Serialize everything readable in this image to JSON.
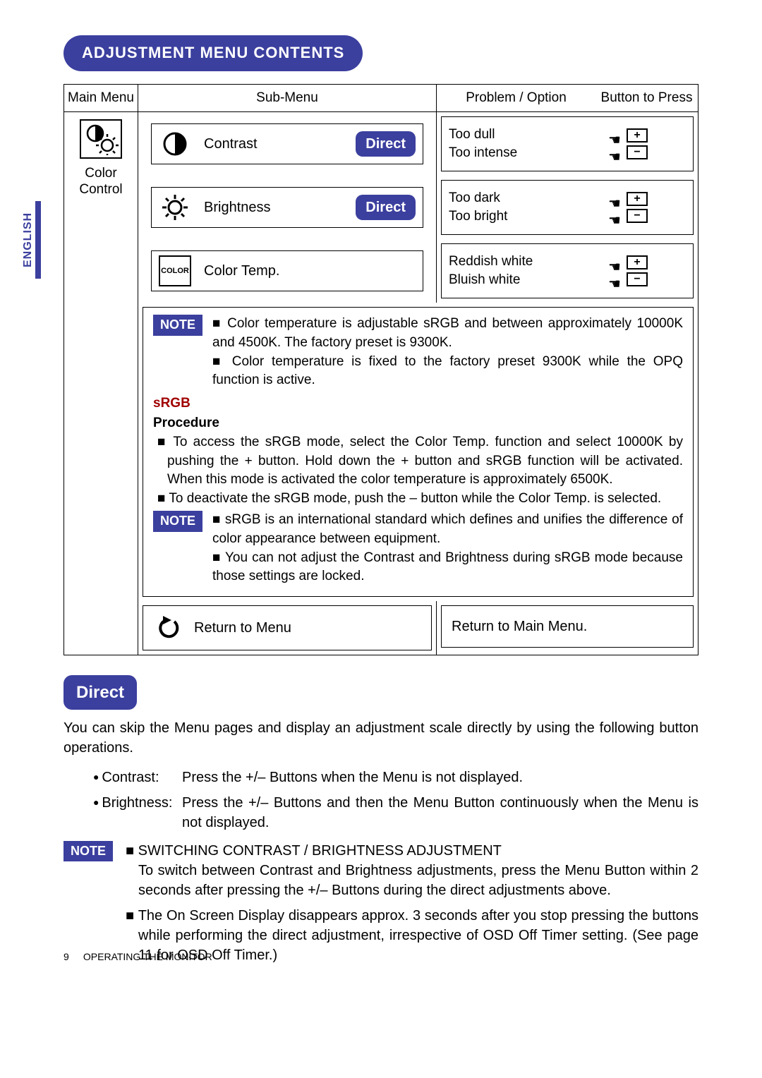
{
  "lang_tab": "ENGLISH",
  "title": "ADJUSTMENT MENU CONTENTS",
  "headers": {
    "main_menu": "Main Menu",
    "sub_menu": "Sub-Menu",
    "problem_option": "Problem / Option",
    "button_to_press": "Button to Press"
  },
  "main_menu_label": "Color Control",
  "direct_label": "Direct",
  "rows": {
    "contrast": {
      "label": "Contrast",
      "problem1": "Too dull",
      "problem2": "Too intense",
      "btn_plus": "+",
      "btn_minus": "−"
    },
    "brightness": {
      "label": "Brightness",
      "problem1": "Too dark",
      "problem2": "Too bright",
      "btn_plus": "+",
      "btn_minus": "−"
    },
    "colortemp": {
      "icon_label": "COLOR",
      "label": "Color Temp.",
      "problem1": "Reddish white",
      "problem2": "Bluish white",
      "btn_plus": "+",
      "btn_minus": "−"
    }
  },
  "note1_label": "NOTE",
  "note1_b1": "Color temperature is adjustable sRGB and between approximately 10000K and 4500K. The factory preset is 9300K.",
  "note1_b2": "Color temperature is fixed to the factory preset 9300K while the OPQ function is active.",
  "srgb_heading": "sRGB",
  "procedure_heading": "Procedure",
  "proc_b1": "To access the sRGB mode, select the Color Temp. function and select 10000K by pushing the + button. Hold down the + button and sRGB function will be activated. When this mode is activated the color temperature is approximately 6500K.",
  "proc_b2": "To deactivate the sRGB mode, push the – button while the Color Temp. is selected.",
  "note2_label": "NOTE",
  "note2_b1": "sRGB is an international standard which defines and unifies the difference of color appearance between equipment.",
  "note2_b2": "You can not adjust the Contrast and Brightness during sRGB mode because those settings are locked.",
  "return": {
    "label": "Return to Menu",
    "desc": "Return to Main Menu."
  },
  "direct_section": {
    "heading": "Direct",
    "para": "You can skip the Menu pages and display an adjustment scale directly by using the following button operations.",
    "contrast_term": "Contrast:",
    "contrast_body": "Press the +/– Buttons when the Menu is not displayed.",
    "brightness_term": "Brightness:",
    "brightness_body": "Press the +/– Buttons and then the Menu Button continuously when the Menu is not displayed."
  },
  "bottom_note": {
    "label": "NOTE",
    "b1_head": "SWITCHING CONTRAST / BRIGHTNESS ADJUSTMENT",
    "b1_body": "To switch between Contrast and Brightness adjustments, press the Menu Button within 2 seconds after pressing the +/– Buttons during the direct adjustments above.",
    "b2": "The On Screen Display disappears approx. 3 seconds after you stop pressing the buttons while performing the direct adjustment, irrespective of OSD Off Timer setting. (See page 11 for OSD Off Timer.)"
  },
  "footer": {
    "page": "9",
    "section": "OPERATING THE MONITOR"
  }
}
